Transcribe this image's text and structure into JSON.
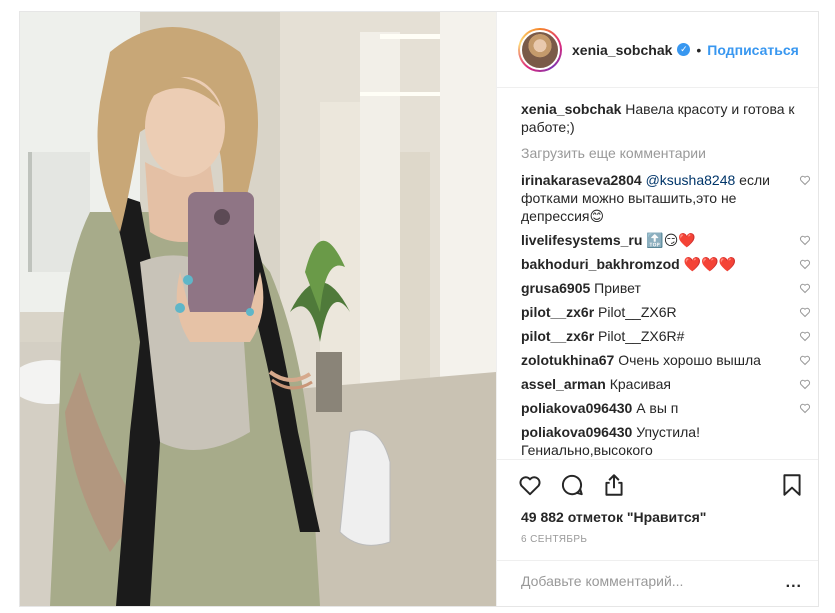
{
  "header": {
    "username": "xenia_sobchak",
    "separator": "•",
    "follow_label": "Подписаться",
    "verified_icon": "check"
  },
  "caption": {
    "username": "xenia_sobchak",
    "text": "Навела красоту и готова к работе;)"
  },
  "load_more_label": "Загрузить еще комментарии",
  "comments": [
    {
      "username": "irinakaraseva2804",
      "mention": "@ksusha8248",
      "text": "если фотками можно выташить,это не депрессия😊"
    },
    {
      "username": "livelifesystems_ru",
      "mention": "",
      "text": "🔝😏❤️"
    },
    {
      "username": "bakhoduri_bakhromzod",
      "mention": "",
      "text": "❤️❤️❤️"
    },
    {
      "username": "grusa6905",
      "mention": "",
      "text": "Привет"
    },
    {
      "username": "pilot__zx6r",
      "mention": "",
      "text": "Pilot__ZX6R"
    },
    {
      "username": "pilot__zx6r",
      "mention": "",
      "text": "Pilot__ZX6R#"
    },
    {
      "username": "zolotukhina67",
      "mention": "",
      "text": "Очень хорошо вышла"
    },
    {
      "username": "assel_arman",
      "mention": "",
      "text": "Красивая"
    },
    {
      "username": "poliakova096430",
      "mention": "",
      "text": "А вы п"
    },
    {
      "username": "poliakova096430",
      "mention": "",
      "text": "Упустила! Гениально,высокого"
    }
  ],
  "likes_label": "49 882 отметок \"Нравится\"",
  "date_label": "6 СЕНТЯБРЬ",
  "add_comment_placeholder": "Добавьте комментарий...",
  "more_label": "...",
  "icons": {
    "like": "heart-outline-icon",
    "comment": "speech-bubble-icon",
    "share": "share-upload-icon",
    "save": "bookmark-icon"
  }
}
